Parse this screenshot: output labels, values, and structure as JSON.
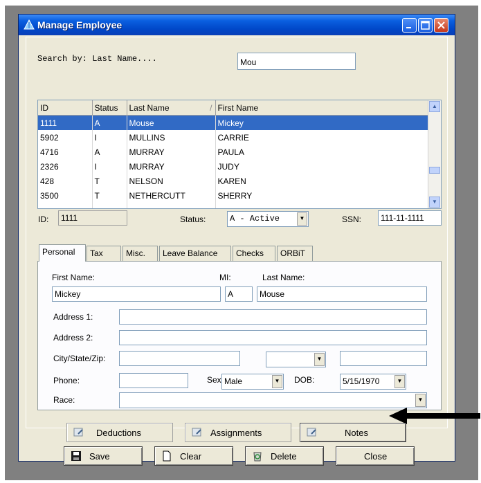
{
  "window": {
    "title": "Manage Employee"
  },
  "search": {
    "label": "Search by: Last Name....",
    "value": "Mou"
  },
  "grid": {
    "columns": [
      "ID",
      "Status",
      "Last Name",
      "First Name"
    ],
    "sort_indicator": "/",
    "rows": [
      {
        "id": "1111",
        "status": "A",
        "last": "Mouse",
        "first": "Mickey",
        "selected": true
      },
      {
        "id": "5902",
        "status": "I",
        "last": "MULLINS",
        "first": "CARRIE"
      },
      {
        "id": "4716",
        "status": "A",
        "last": "MURRAY",
        "first": "PAULA"
      },
      {
        "id": "2326",
        "status": "I",
        "last": "MURRAY",
        "first": "JUDY"
      },
      {
        "id": "428",
        "status": "T",
        "last": "NELSON",
        "first": "KAREN"
      },
      {
        "id": "3500",
        "status": "T",
        "last": "NETHERCUTT",
        "first": "SHERRY"
      }
    ]
  },
  "record": {
    "id_label": "ID:",
    "id_value": "1111",
    "status_label": "Status:",
    "status_value": "A - Active",
    "ssn_label": "SSN:",
    "ssn_value": "111-11-1111"
  },
  "tabs": [
    "Personal",
    "Tax",
    "Misc.",
    "Leave Balance",
    "Checks",
    "ORBiT"
  ],
  "personal": {
    "first_name_label": "First Name:",
    "first_name": "Mickey",
    "mi_label": "MI:",
    "mi": "A",
    "last_name_label": "Last Name:",
    "last_name": "Mouse",
    "address1_label": "Address 1:",
    "address1": "",
    "address2_label": "Address 2:",
    "address2": "",
    "city_label": "City/State/Zip:",
    "city": "",
    "state": "",
    "zip": "",
    "phone_label": "Phone:",
    "phone": "",
    "sex_label": "Sex:",
    "sex": "Male",
    "dob_label": "DOB:",
    "dob": "5/15/1970",
    "race_label": "Race:",
    "race": ""
  },
  "buttons": {
    "deductions": "Deductions",
    "assignments": "Assignments",
    "notes": "Notes",
    "save": "Save",
    "clear": "Clear",
    "delete": "Delete",
    "close": "Close"
  },
  "colors": {
    "selection": "#316ac5",
    "titlebar": "#0a5fe0",
    "face": "#ece9d8"
  },
  "icons": [
    "app-icon",
    "minimize-icon",
    "maximize-icon",
    "close-icon",
    "scroll-up-icon",
    "scroll-down-icon",
    "dropdown-arrow-icon",
    "edit-doc-icon",
    "save-disk-icon",
    "new-page-icon",
    "recycle-bin-icon",
    "pointer-arrow-icon"
  ]
}
